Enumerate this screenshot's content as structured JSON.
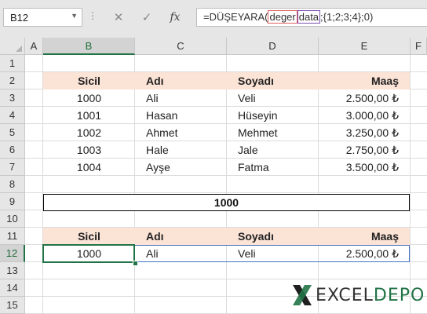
{
  "formula_bar": {
    "name_box": "B12",
    "formula_prefix": "=DÜŞEYARA(",
    "arg1": "deger",
    "arg2": "data",
    "formula_suffix": ";{1;2;3;4};0)"
  },
  "columns": [
    "A",
    "B",
    "C",
    "D",
    "E",
    "F"
  ],
  "selected_column": "B",
  "rows": [
    "1",
    "2",
    "3",
    "4",
    "5",
    "6",
    "7",
    "8",
    "9",
    "10",
    "11",
    "12",
    "13",
    "14",
    "15"
  ],
  "selected_row": "12",
  "table": {
    "headers": [
      "Sicil",
      "Adı",
      "Soyadı",
      "Maaş"
    ],
    "records": [
      [
        "1000",
        "Ali",
        "Veli",
        "2.500,00 ₺"
      ],
      [
        "1001",
        "Hasan",
        "Hüseyin",
        "3.000,00 ₺"
      ],
      [
        "1002",
        "Ahmet",
        "Mehmet",
        "3.250,00 ₺"
      ],
      [
        "1003",
        "Hale",
        "Jale",
        "2.750,00 ₺"
      ],
      [
        "1004",
        "Ayşe",
        "Fatma",
        "3.500,00 ₺"
      ]
    ]
  },
  "lookup_value": "1000",
  "result": {
    "headers": [
      "Sicil",
      "Adı",
      "Soyadı",
      "Maaş"
    ],
    "values": [
      "1000",
      "Ali",
      "Veli",
      "2.500,00 ₺"
    ]
  },
  "logo": {
    "excel": "EXCEL",
    "depo": "DEPO"
  },
  "colors": {
    "header_fill": "#fbe3d6",
    "excel_green": "#217346",
    "range_blue": "#4472c4"
  }
}
